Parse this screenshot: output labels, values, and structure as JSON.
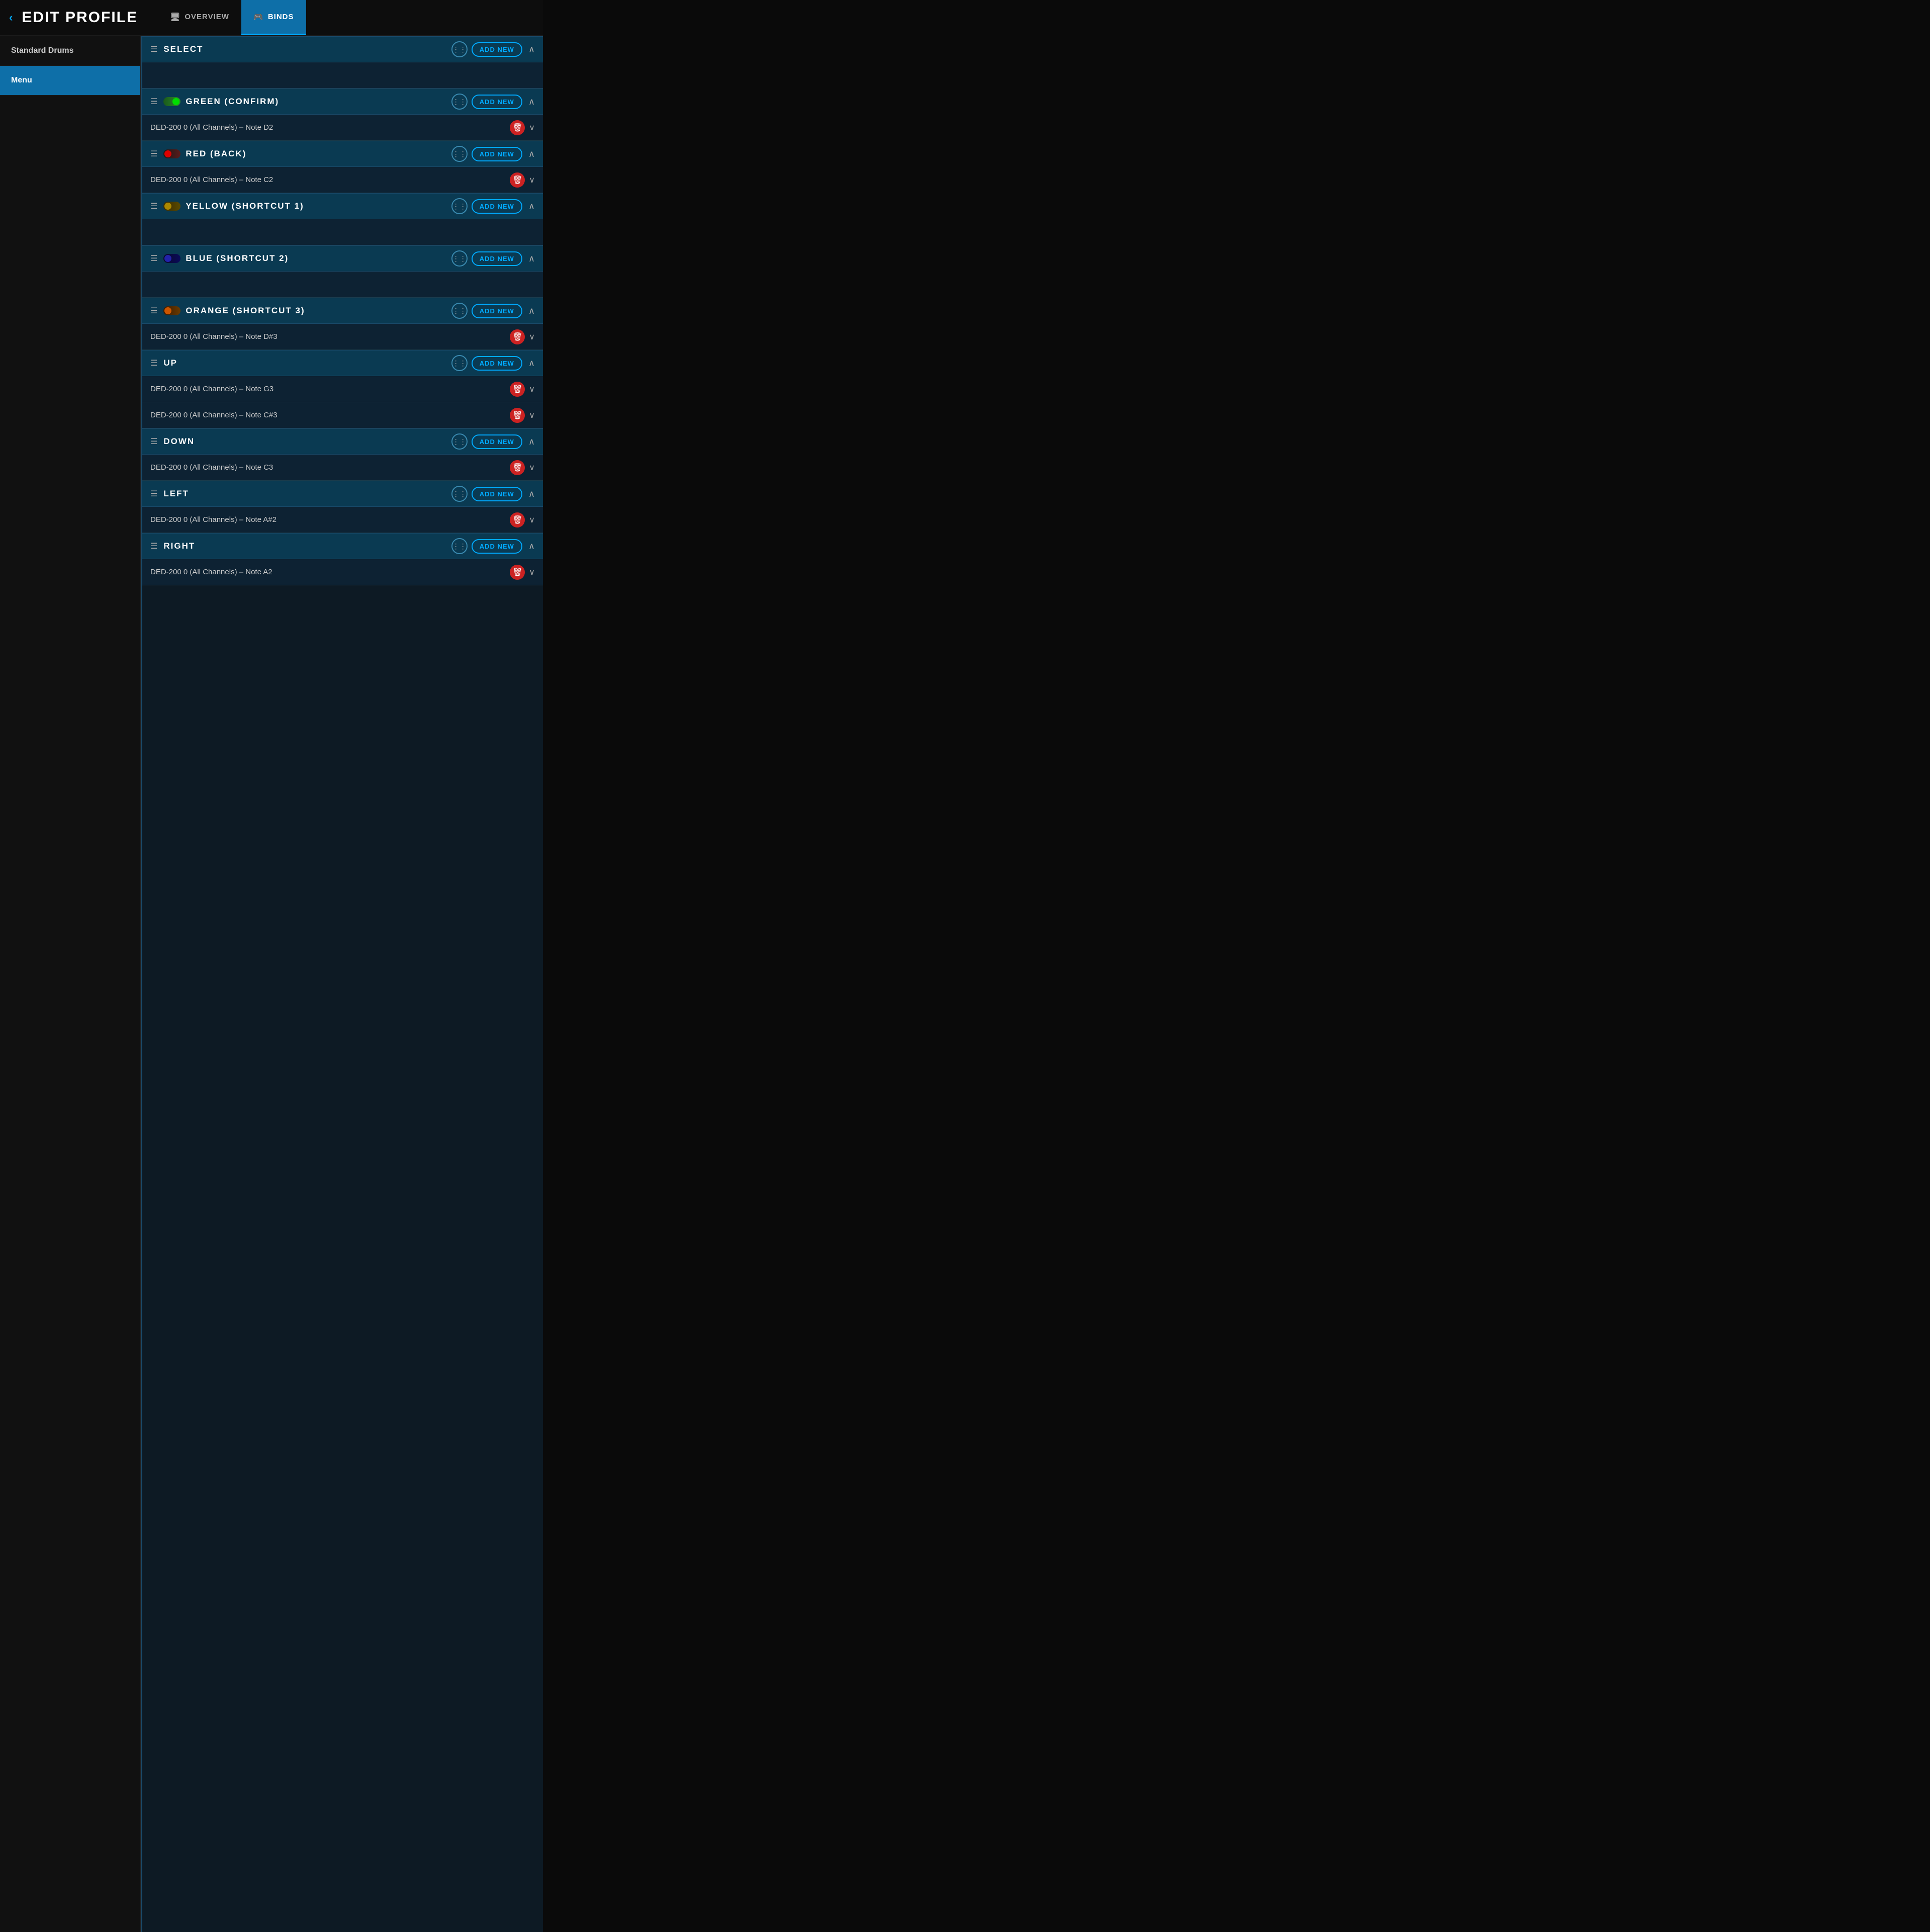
{
  "header": {
    "back_label": "‹",
    "title": "EDIT PROFILE",
    "tabs": [
      {
        "id": "overview",
        "label": "OVERVIEW",
        "icon": "🖥",
        "active": false
      },
      {
        "id": "binds",
        "label": "BINDS",
        "icon": "🎮",
        "active": true
      }
    ]
  },
  "sidebar": {
    "items": [
      {
        "id": "standard-drums",
        "label": "Standard Drums",
        "active": false
      },
      {
        "id": "menu",
        "label": "Menu",
        "active": true
      }
    ]
  },
  "sections": [
    {
      "id": "select",
      "title": "SELECT",
      "toggle": null,
      "add_new_label": "ADD NEW",
      "collapsed": false,
      "bindings": []
    },
    {
      "id": "green-confirm",
      "title": "GREEN (CONFIRM)",
      "toggle": "green",
      "add_new_label": "ADD NEW",
      "collapsed": false,
      "bindings": [
        {
          "text": "DED-200 0 (All Channels) – Note D2"
        }
      ]
    },
    {
      "id": "red-back",
      "title": "RED (BACK)",
      "toggle": "red",
      "add_new_label": "ADD NEW",
      "collapsed": false,
      "bindings": [
        {
          "text": "DED-200 0 (All Channels) – Note C2"
        }
      ]
    },
    {
      "id": "yellow-shortcut1",
      "title": "YELLOW (SHORTCUT 1)",
      "toggle": "yellow",
      "add_new_label": "ADD NEW",
      "collapsed": false,
      "bindings": []
    },
    {
      "id": "blue-shortcut2",
      "title": "BLUE (SHORTCUT 2)",
      "toggle": "blue",
      "add_new_label": "ADD NEW",
      "collapsed": false,
      "bindings": []
    },
    {
      "id": "orange-shortcut3",
      "title": "ORANGE (SHORTCUT 3)",
      "toggle": "orange",
      "add_new_label": "ADD NEW",
      "collapsed": false,
      "bindings": [
        {
          "text": "DED-200 0 (All Channels) – Note D#3"
        }
      ]
    },
    {
      "id": "up",
      "title": "UP",
      "toggle": null,
      "add_new_label": "ADD NEW",
      "collapsed": false,
      "bindings": [
        {
          "text": "DED-200 0 (All Channels) – Note G3"
        },
        {
          "text": "DED-200 0 (All Channels) – Note C#3"
        }
      ]
    },
    {
      "id": "down",
      "title": "DOWN",
      "toggle": null,
      "add_new_label": "ADD NEW",
      "collapsed": false,
      "bindings": [
        {
          "text": "DED-200 0 (All Channels) – Note C3"
        }
      ]
    },
    {
      "id": "left",
      "title": "LEFT",
      "toggle": null,
      "add_new_label": "ADD NEW",
      "collapsed": false,
      "bindings": [
        {
          "text": "DED-200 0 (All Channels) – Note A#2"
        }
      ]
    },
    {
      "id": "right",
      "title": "RIGHT",
      "toggle": null,
      "add_new_label": "ADD NEW",
      "collapsed": false,
      "bindings": [
        {
          "text": "DED-200 0 (All Channels) – Note A2"
        }
      ]
    }
  ],
  "icons": {
    "back": "‹",
    "chevron_up": "∧",
    "chevron_down": "∨",
    "delete": "🗑",
    "options": "⋮⋮",
    "monitor": "🖥",
    "gamepad": "🎮"
  }
}
